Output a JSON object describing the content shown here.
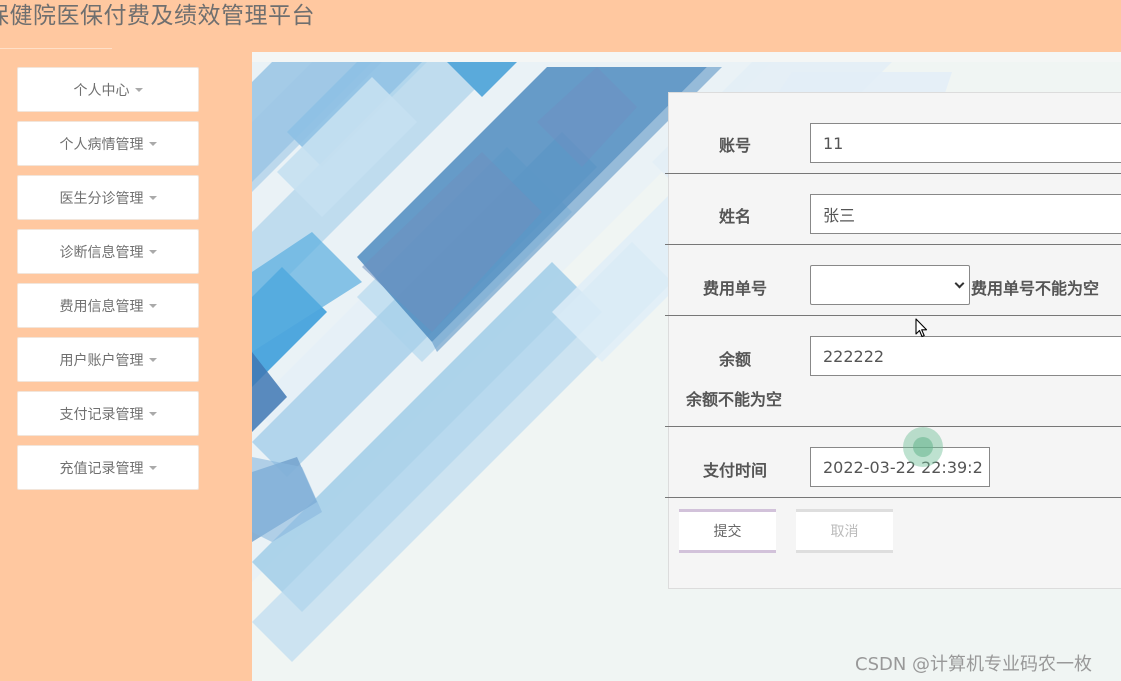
{
  "app": {
    "title": "保健院医保付费及绩效管理平台"
  },
  "sidebar": {
    "items": [
      {
        "label": "个人中心"
      },
      {
        "label": "个人病情管理"
      },
      {
        "label": "医生分诊管理"
      },
      {
        "label": "诊断信息管理"
      },
      {
        "label": "费用信息管理"
      },
      {
        "label": "用户账户管理"
      },
      {
        "label": "支付记录管理"
      },
      {
        "label": "充值记录管理"
      }
    ]
  },
  "form": {
    "account": {
      "label": "账号",
      "value": "11"
    },
    "name": {
      "label": "姓名",
      "value": "张三"
    },
    "fee_no": {
      "label": "费用单号",
      "value": "",
      "error": "费用单号不能为空"
    },
    "balance": {
      "label": "余额",
      "value": "222222",
      "error": "余额不能为空"
    },
    "pay_time": {
      "label": "支付时间",
      "value": "2022-03-22 22:39:2"
    },
    "submit_label": "提交",
    "cancel_label": "取消"
  },
  "watermark": "CSDN @计算机专业码农一枚",
  "colors": {
    "header_bg": "#ffc8a0",
    "sidebar_bg": "#ffc8a0",
    "content_bg": "#f0f5f3",
    "accent_blue": "#3f78b4"
  }
}
